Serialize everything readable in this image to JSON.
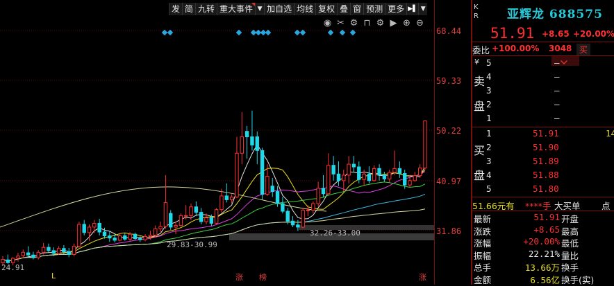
{
  "toolbar": {
    "items": [
      "发",
      "简",
      "九转",
      "重大事件",
      "加自选",
      "均线",
      "复权",
      "叠",
      "窗",
      "预测",
      "更多"
    ]
  },
  "icons": [
    "eye-icon",
    "scissors-icon",
    "gear-icon",
    "lock-icon",
    "gear-icon",
    "play-icon",
    "zoom-in-icon",
    "zoom-out-icon"
  ],
  "chart": {
    "y_ticks": [
      "68.44",
      "59.33",
      "50.22",
      "40.97",
      "31.86"
    ],
    "low_label": "24.91",
    "range_annotations": [
      "32.26-33.00",
      "29.83-30.99"
    ],
    "markers_red": [
      "涨",
      "榜",
      "涨"
    ],
    "marker_yellow": "L"
  },
  "chart_data": {
    "type": "candlestick",
    "title": "",
    "y_ticks": [
      68.44,
      59.33,
      50.22,
      40.97,
      31.86
    ],
    "y_range": [
      24.91,
      71.5
    ],
    "candles": [
      {
        "o": 26.0,
        "h": 27.2,
        "l": 25.4,
        "c": 26.6
      },
      {
        "o": 26.5,
        "h": 27.5,
        "l": 25.8,
        "c": 26.0
      },
      {
        "o": 26.0,
        "h": 27.0,
        "l": 25.5,
        "c": 26.8
      },
      {
        "o": 26.8,
        "h": 27.8,
        "l": 26.2,
        "c": 27.2
      },
      {
        "o": 27.3,
        "h": 28.4,
        "l": 26.8,
        "c": 27.9
      },
      {
        "o": 27.8,
        "h": 29.0,
        "l": 27.0,
        "c": 27.4
      },
      {
        "o": 27.4,
        "h": 28.0,
        "l": 26.6,
        "c": 26.9
      },
      {
        "o": 26.9,
        "h": 28.3,
        "l": 26.6,
        "c": 27.9
      },
      {
        "o": 27.9,
        "h": 29.6,
        "l": 27.5,
        "c": 28.8
      },
      {
        "o": 28.8,
        "h": 29.5,
        "l": 27.9,
        "c": 28.2
      },
      {
        "o": 28.2,
        "h": 28.8,
        "l": 27.2,
        "c": 27.7
      },
      {
        "o": 27.7,
        "h": 29.0,
        "l": 27.4,
        "c": 28.6
      },
      {
        "o": 28.6,
        "h": 29.2,
        "l": 27.6,
        "c": 28.0
      },
      {
        "o": 28.0,
        "h": 28.7,
        "l": 27.0,
        "c": 27.5
      },
      {
        "o": 27.5,
        "h": 29.5,
        "l": 27.2,
        "c": 29.0
      },
      {
        "o": 29.0,
        "h": 33.5,
        "l": 28.7,
        "c": 33.0
      },
      {
        "o": 33.0,
        "h": 33.8,
        "l": 31.0,
        "c": 31.5
      },
      {
        "o": 31.5,
        "h": 33.0,
        "l": 30.0,
        "c": 32.5
      },
      {
        "o": 32.5,
        "h": 33.8,
        "l": 31.4,
        "c": 33.2
      },
      {
        "o": 33.2,
        "h": 34.0,
        "l": 31.0,
        "c": 31.6
      },
      {
        "o": 31.6,
        "h": 32.4,
        "l": 30.4,
        "c": 30.9
      },
      {
        "o": 30.9,
        "h": 31.8,
        "l": 29.8,
        "c": 30.5
      },
      {
        "o": 30.5,
        "h": 31.2,
        "l": 29.7,
        "c": 30.1
      },
      {
        "o": 30.1,
        "h": 31.4,
        "l": 29.9,
        "c": 30.9
      },
      {
        "o": 30.9,
        "h": 31.4,
        "l": 30.0,
        "c": 30.3
      },
      {
        "o": 30.3,
        "h": 31.6,
        "l": 30.0,
        "c": 31.2
      },
      {
        "o": 31.2,
        "h": 31.5,
        "l": 30.1,
        "c": 30.4
      },
      {
        "o": 30.4,
        "h": 30.9,
        "l": 29.8,
        "c": 30.2
      },
      {
        "o": 30.2,
        "h": 31.2,
        "l": 29.9,
        "c": 30.8
      },
      {
        "o": 30.8,
        "h": 31.8,
        "l": 30.2,
        "c": 31.0
      },
      {
        "o": 31.0,
        "h": 32.8,
        "l": 30.6,
        "c": 32.2
      },
      {
        "o": 32.2,
        "h": 33.5,
        "l": 31.6,
        "c": 32.6
      },
      {
        "o": 32.6,
        "h": 42.0,
        "l": 32.2,
        "c": 37.0
      },
      {
        "o": 35.0,
        "h": 35.6,
        "l": 32.0,
        "c": 32.5
      },
      {
        "o": 32.5,
        "h": 33.5,
        "l": 31.2,
        "c": 32.8
      },
      {
        "o": 32.8,
        "h": 35.0,
        "l": 32.6,
        "c": 34.6
      },
      {
        "o": 34.6,
        "h": 36.5,
        "l": 33.9,
        "c": 34.6
      },
      {
        "o": 34.6,
        "h": 36.8,
        "l": 33.8,
        "c": 36.2
      },
      {
        "o": 36.2,
        "h": 37.2,
        "l": 34.5,
        "c": 35.2
      },
      {
        "o": 35.2,
        "h": 36.0,
        "l": 33.0,
        "c": 33.5
      },
      {
        "o": 33.5,
        "h": 35.0,
        "l": 33.0,
        "c": 34.2
      },
      {
        "o": 34.2,
        "h": 34.8,
        "l": 32.7,
        "c": 33.2
      },
      {
        "o": 33.2,
        "h": 36.0,
        "l": 33.0,
        "c": 35.7
      },
      {
        "o": 35.7,
        "h": 39.5,
        "l": 35.2,
        "c": 38.2
      },
      {
        "o": 38.2,
        "h": 40.5,
        "l": 37.0,
        "c": 37.5
      },
      {
        "o": 37.5,
        "h": 38.5,
        "l": 36.8,
        "c": 38.0
      },
      {
        "o": 38.0,
        "h": 49.0,
        "l": 37.8,
        "c": 46.0
      },
      {
        "o": 46.0,
        "h": 53.5,
        "l": 44.0,
        "c": 49.0
      },
      {
        "o": 50.0,
        "h": 51.0,
        "l": 45.0,
        "c": 49.0
      },
      {
        "o": 49.0,
        "h": 53.8,
        "l": 46.5,
        "c": 47.5
      },
      {
        "o": 49.0,
        "h": 50.0,
        "l": 44.0,
        "c": 46.5
      },
      {
        "o": 46.5,
        "h": 47.0,
        "l": 37.5,
        "c": 38.5
      },
      {
        "o": 38.5,
        "h": 44.0,
        "l": 38.2,
        "c": 41.8
      },
      {
        "o": 40.0,
        "h": 41.5,
        "l": 38.0,
        "c": 39.0
      },
      {
        "o": 39.0,
        "h": 40.0,
        "l": 36.2,
        "c": 36.8
      },
      {
        "o": 36.8,
        "h": 38.0,
        "l": 35.0,
        "c": 35.4
      },
      {
        "o": 35.4,
        "h": 36.0,
        "l": 33.0,
        "c": 33.6
      },
      {
        "o": 33.6,
        "h": 34.5,
        "l": 32.5,
        "c": 32.9
      },
      {
        "o": 32.9,
        "h": 33.8,
        "l": 31.8,
        "c": 32.5
      },
      {
        "o": 32.5,
        "h": 36.0,
        "l": 32.3,
        "c": 35.6
      },
      {
        "o": 35.6,
        "h": 36.5,
        "l": 34.5,
        "c": 35.6
      },
      {
        "o": 35.6,
        "h": 37.2,
        "l": 35.0,
        "c": 36.8
      },
      {
        "o": 36.8,
        "h": 40.8,
        "l": 36.2,
        "c": 39.6
      },
      {
        "o": 39.6,
        "h": 42.0,
        "l": 38.0,
        "c": 38.6
      },
      {
        "o": 38.6,
        "h": 46.0,
        "l": 38.4,
        "c": 43.8
      },
      {
        "o": 43.8,
        "h": 45.5,
        "l": 41.0,
        "c": 42.2
      },
      {
        "o": 42.2,
        "h": 44.5,
        "l": 40.0,
        "c": 41.0
      },
      {
        "o": 41.0,
        "h": 43.0,
        "l": 39.0,
        "c": 42.0
      },
      {
        "o": 42.0,
        "h": 45.5,
        "l": 40.5,
        "c": 44.0
      },
      {
        "o": 44.0,
        "h": 45.5,
        "l": 42.5,
        "c": 43.5
      },
      {
        "o": 43.5,
        "h": 44.5,
        "l": 40.5,
        "c": 41.2
      },
      {
        "o": 41.2,
        "h": 43.0,
        "l": 40.0,
        "c": 42.2
      },
      {
        "o": 42.2,
        "h": 43.6,
        "l": 40.5,
        "c": 41.0
      },
      {
        "o": 41.0,
        "h": 43.8,
        "l": 40.8,
        "c": 43.2
      },
      {
        "o": 43.2,
        "h": 44.0,
        "l": 41.0,
        "c": 42.0
      },
      {
        "o": 42.0,
        "h": 42.6,
        "l": 40.8,
        "c": 41.3
      },
      {
        "o": 41.3,
        "h": 43.0,
        "l": 40.7,
        "c": 42.5
      },
      {
        "o": 42.5,
        "h": 46.5,
        "l": 42.0,
        "c": 43.2
      },
      {
        "o": 43.2,
        "h": 44.5,
        "l": 41.5,
        "c": 42.3
      },
      {
        "o": 42.3,
        "h": 43.0,
        "l": 39.5,
        "c": 40.2
      },
      {
        "o": 40.2,
        "h": 42.0,
        "l": 39.8,
        "c": 41.0
      },
      {
        "o": 41.0,
        "h": 42.6,
        "l": 40.8,
        "c": 41.9
      },
      {
        "o": 41.9,
        "h": 44.0,
        "l": 41.5,
        "c": 43.3
      },
      {
        "o": 43.3,
        "h": 51.91,
        "l": 43.0,
        "c": 51.91
      }
    ]
  },
  "panel": {
    "kr": [
      "K",
      "R"
    ],
    "name": "亚辉龙",
    "code": "688575",
    "price": "51.91",
    "change": "+8.65",
    "pct": "+20.00%",
    "weibi_label": "委比",
    "weibi_value": "+100.00%",
    "weicha": "3048",
    "buy_btn": "买",
    "sell_side_label": "卖盘",
    "yen": "¥",
    "sell_levels": [
      {
        "n": "5",
        "p": "—",
        "v": ""
      },
      {
        "n": "4",
        "p": "—",
        "v": ""
      },
      {
        "n": "3",
        "p": "—",
        "v": ""
      },
      {
        "n": "2",
        "p": "—",
        "v": ""
      },
      {
        "n": "1",
        "p": "—",
        "v": ""
      }
    ],
    "buy_side_label": "买盘",
    "buy_levels": [
      {
        "n": "1",
        "p": "51.91",
        "v": "14"
      },
      {
        "n": "2",
        "p": "51.90",
        "v": ""
      },
      {
        "n": "3",
        "p": "51.89",
        "v": ""
      },
      {
        "n": "4",
        "p": "51.88",
        "v": ""
      },
      {
        "n": "5",
        "p": "51.80",
        "v": ""
      }
    ],
    "big_order": {
      "price": "51.66元有",
      "qty": "****手",
      "label": "大买单",
      "tail": "点"
    },
    "stats": [
      {
        "l1": "最新",
        "v1": "51.91",
        "l2": "开盘",
        "c": "r"
      },
      {
        "l1": "涨跌",
        "v1": "+8.65",
        "l2": "最高",
        "c": "r"
      },
      {
        "l1": "涨幅",
        "v1": "+20.00%",
        "l2": "最低",
        "c": "r"
      },
      {
        "l1": "振幅",
        "v1": "22.21%",
        "l2": "量比",
        "c": "w"
      },
      {
        "l1": "总手",
        "v1": "13.66万",
        "l2": "换手",
        "c": "y"
      },
      {
        "l1": "金额",
        "v1": "6.56亿",
        "l2": "换手(实)",
        "c": "y"
      }
    ]
  }
}
